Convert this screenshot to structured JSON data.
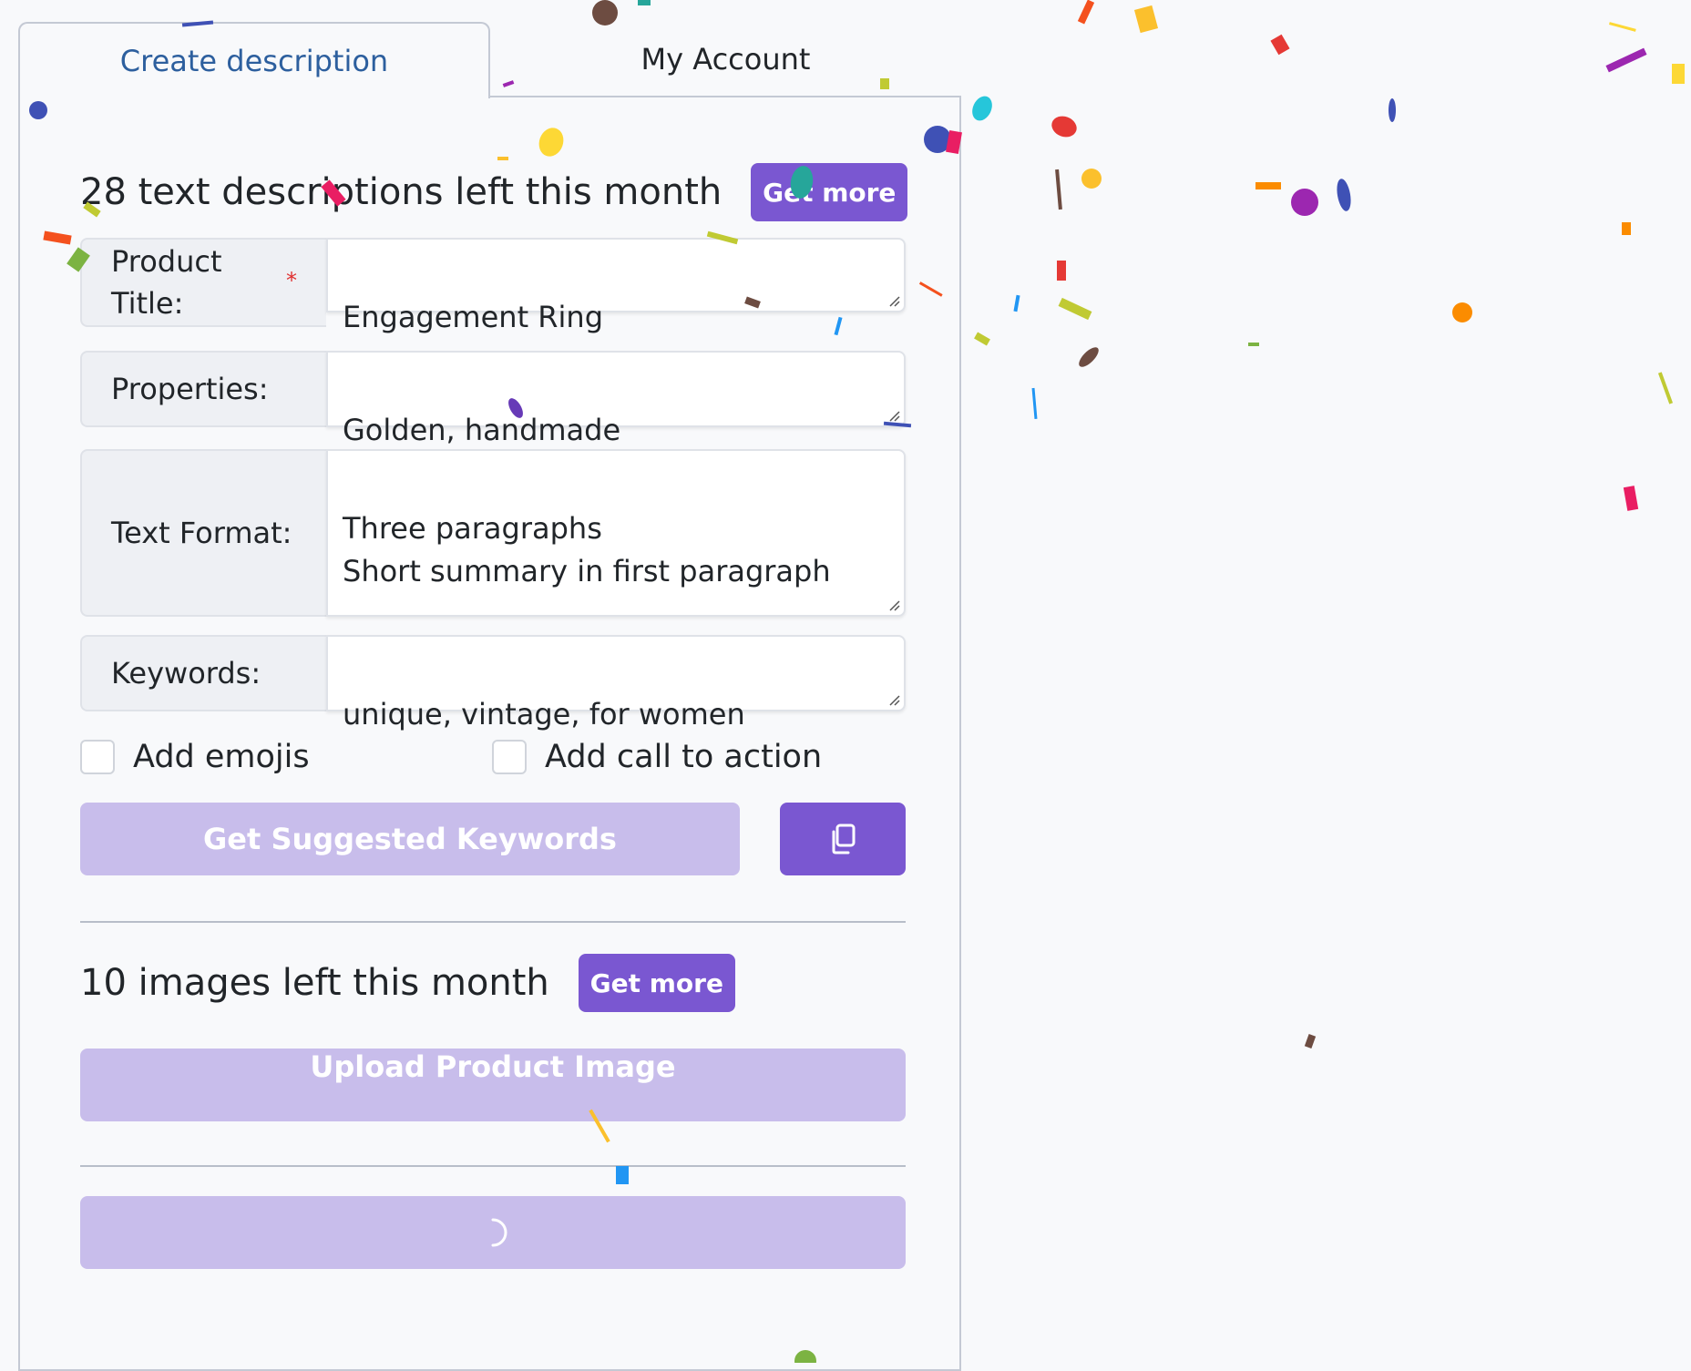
{
  "tabs": {
    "create_label": "Create description",
    "account_label": "My Account"
  },
  "text_section": {
    "heading": "28 text descriptions left this month",
    "get_more_label": "Get more"
  },
  "form": {
    "product_title_label": "Product\nTitle:",
    "product_title_required": "*",
    "product_title_value": "Engagement Ring",
    "properties_label": "Properties:",
    "properties_value": "Golden, handmade",
    "text_format_label": "Text Format:",
    "text_format_value": "Three paragraphs\nShort summary in first paragraph",
    "keywords_label": "Keywords:",
    "keywords_value": "unique, vintage, for women",
    "add_emojis_label": "Add emojis",
    "add_emojis_checked": false,
    "add_cta_label": "Add call to action",
    "add_cta_checked": false
  },
  "buttons": {
    "suggest_keywords_label": "Get Suggested Keywords",
    "copy_icon": "copy-icon"
  },
  "image_section": {
    "heading": "10 images left this month",
    "get_more_label": "Get more",
    "upload_label": "Upload Product Image"
  },
  "generate": {
    "icon": "spinner-icon"
  },
  "colors": {
    "accent": "#7a57d1",
    "accent_light": "#c8bdeb",
    "tab_active_text": "#2d5f9e",
    "required": "#e03131"
  }
}
